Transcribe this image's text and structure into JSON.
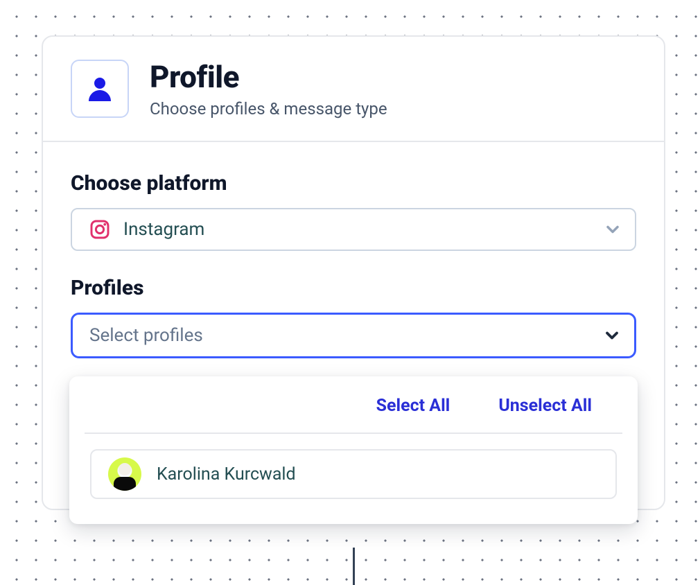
{
  "header": {
    "title": "Profile",
    "subtitle": "Choose profiles & message type",
    "icon": "person-icon"
  },
  "platform": {
    "label": "Choose platform",
    "selected": "Instagram",
    "icon": "instagram-icon"
  },
  "profiles": {
    "label": "Profiles",
    "placeholder": "Select profiles"
  },
  "dropdown": {
    "select_all_label": "Select All",
    "unselect_all_label": "Unselect All",
    "options": [
      {
        "name": "Karolina Kurcwald",
        "avatar_bg": "#d7f94a"
      }
    ]
  },
  "colors": {
    "accent": "#2a2fd6",
    "instagram": "#e1306c",
    "focus_border": "#3b5bff"
  }
}
